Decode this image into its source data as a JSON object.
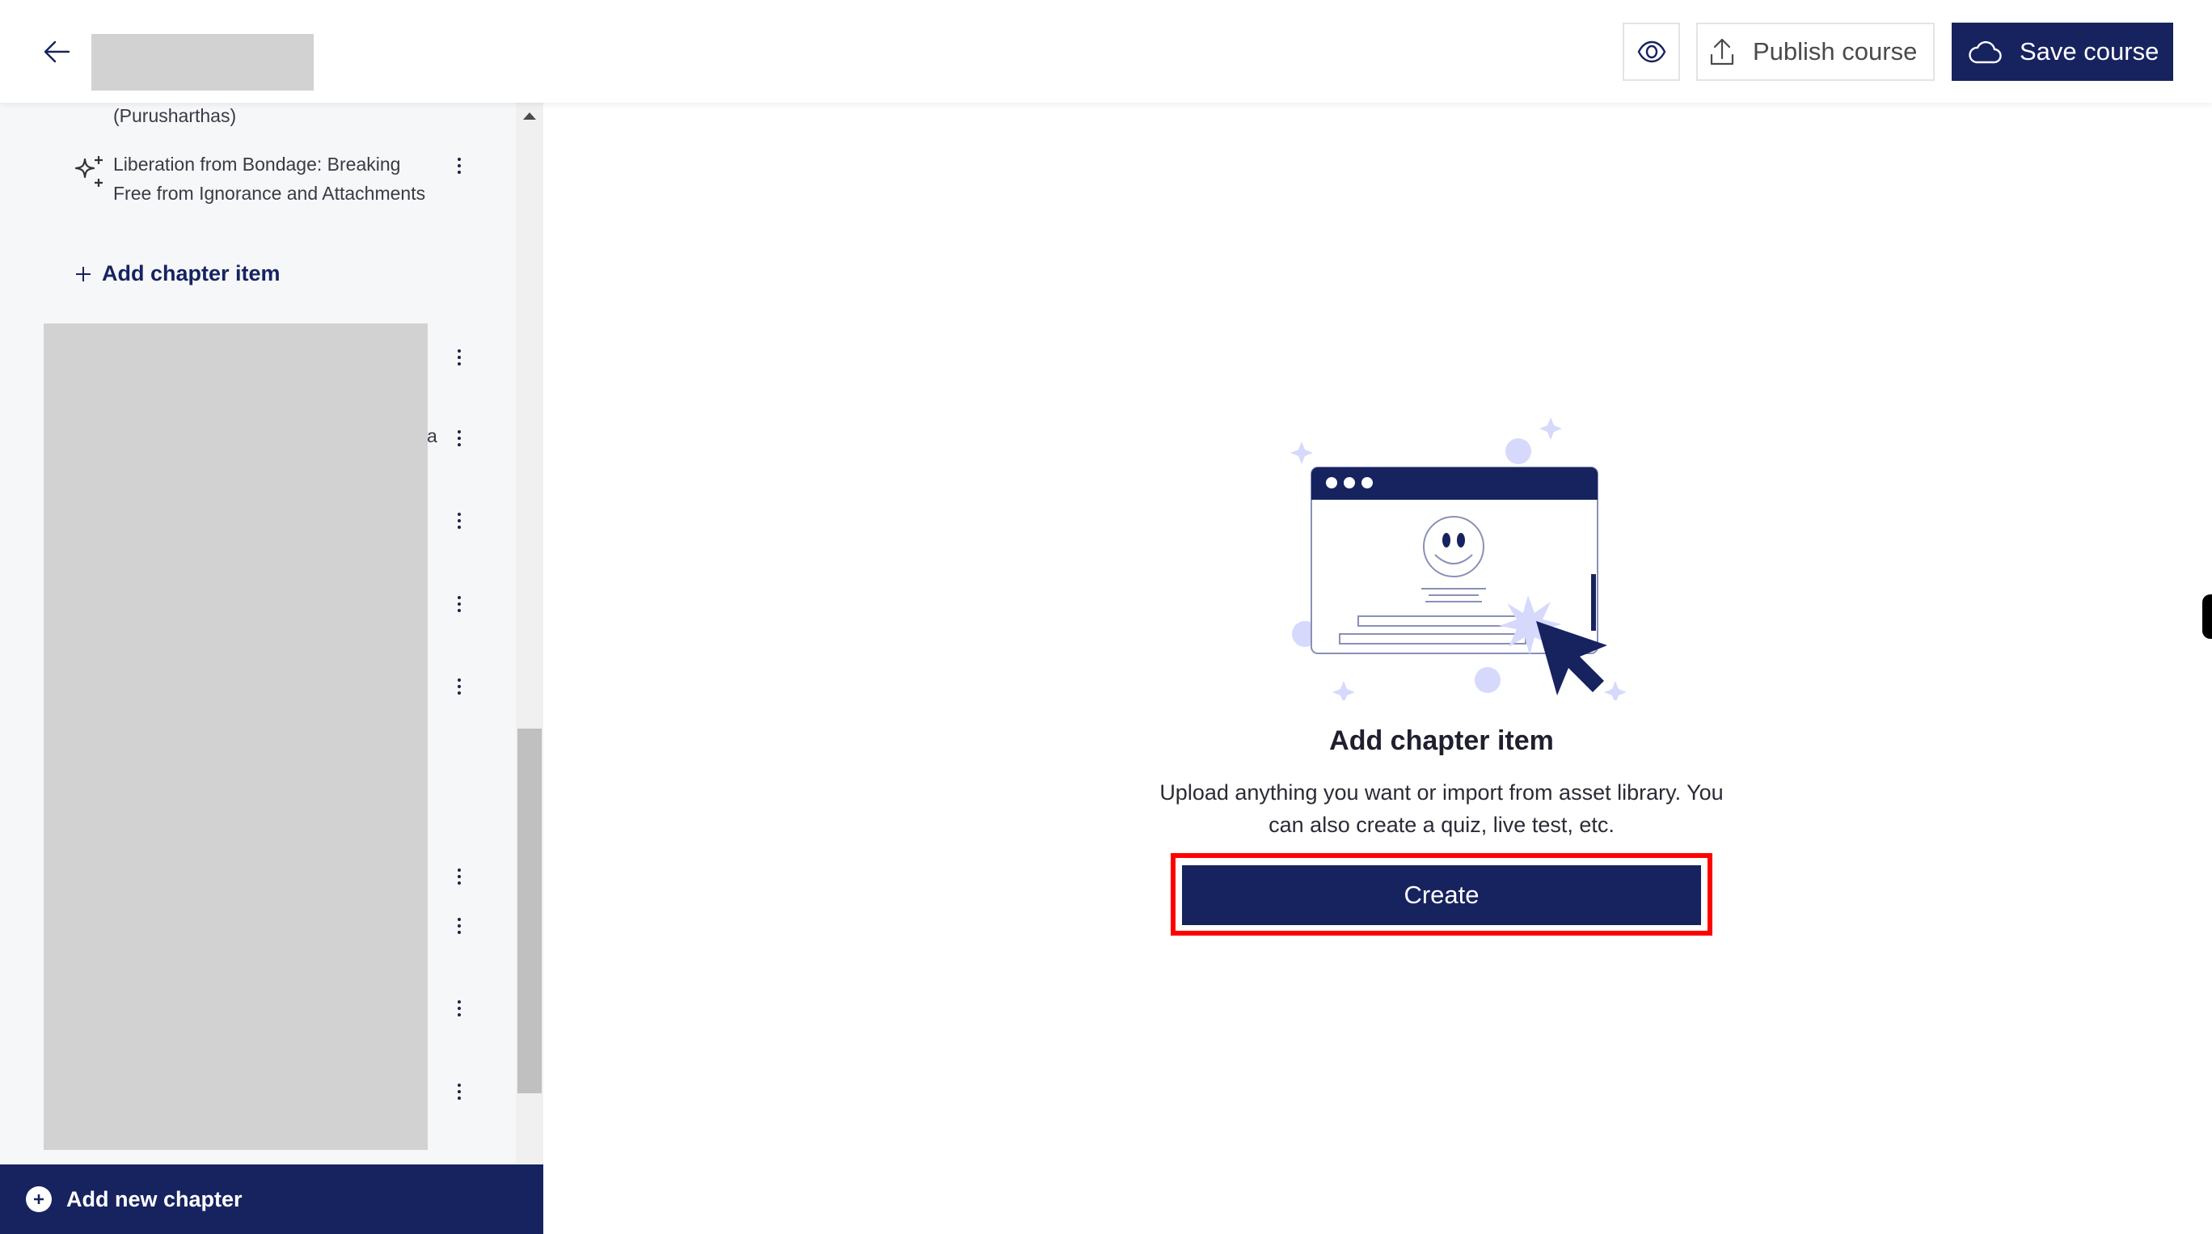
{
  "header": {
    "back_label": "Back",
    "title_redacted": true,
    "preview_icon": "eye-icon",
    "publish_label": "Publish course",
    "publish_icon": "upload-icon",
    "save_label": "Save course",
    "save_icon": "cloud-icon"
  },
  "sidebar": {
    "previous_item_tail": "(Purusharthas)",
    "items": [
      {
        "icon": "sparkle-icon",
        "label": "Liberation from Bondage: Breaking Free from Ignorance and Attachments"
      }
    ],
    "add_item_label": "Add chapter item",
    "redacted_partial_char": "a",
    "redacted_item_menus": 9,
    "add_chapter_label": "Add new chapter"
  },
  "main": {
    "empty_state": {
      "title": "Add chapter item",
      "description": "Upload anything you want or import from asset library. You can also create a quiz, live test, etc.",
      "create_label": "Create"
    }
  },
  "colors": {
    "brand": "#17235f",
    "highlight": "#ff0000",
    "sidebar_bg": "#f6f7f9",
    "redaction": "#d2d2d2",
    "illustration_accent": "#d6d9fb"
  }
}
